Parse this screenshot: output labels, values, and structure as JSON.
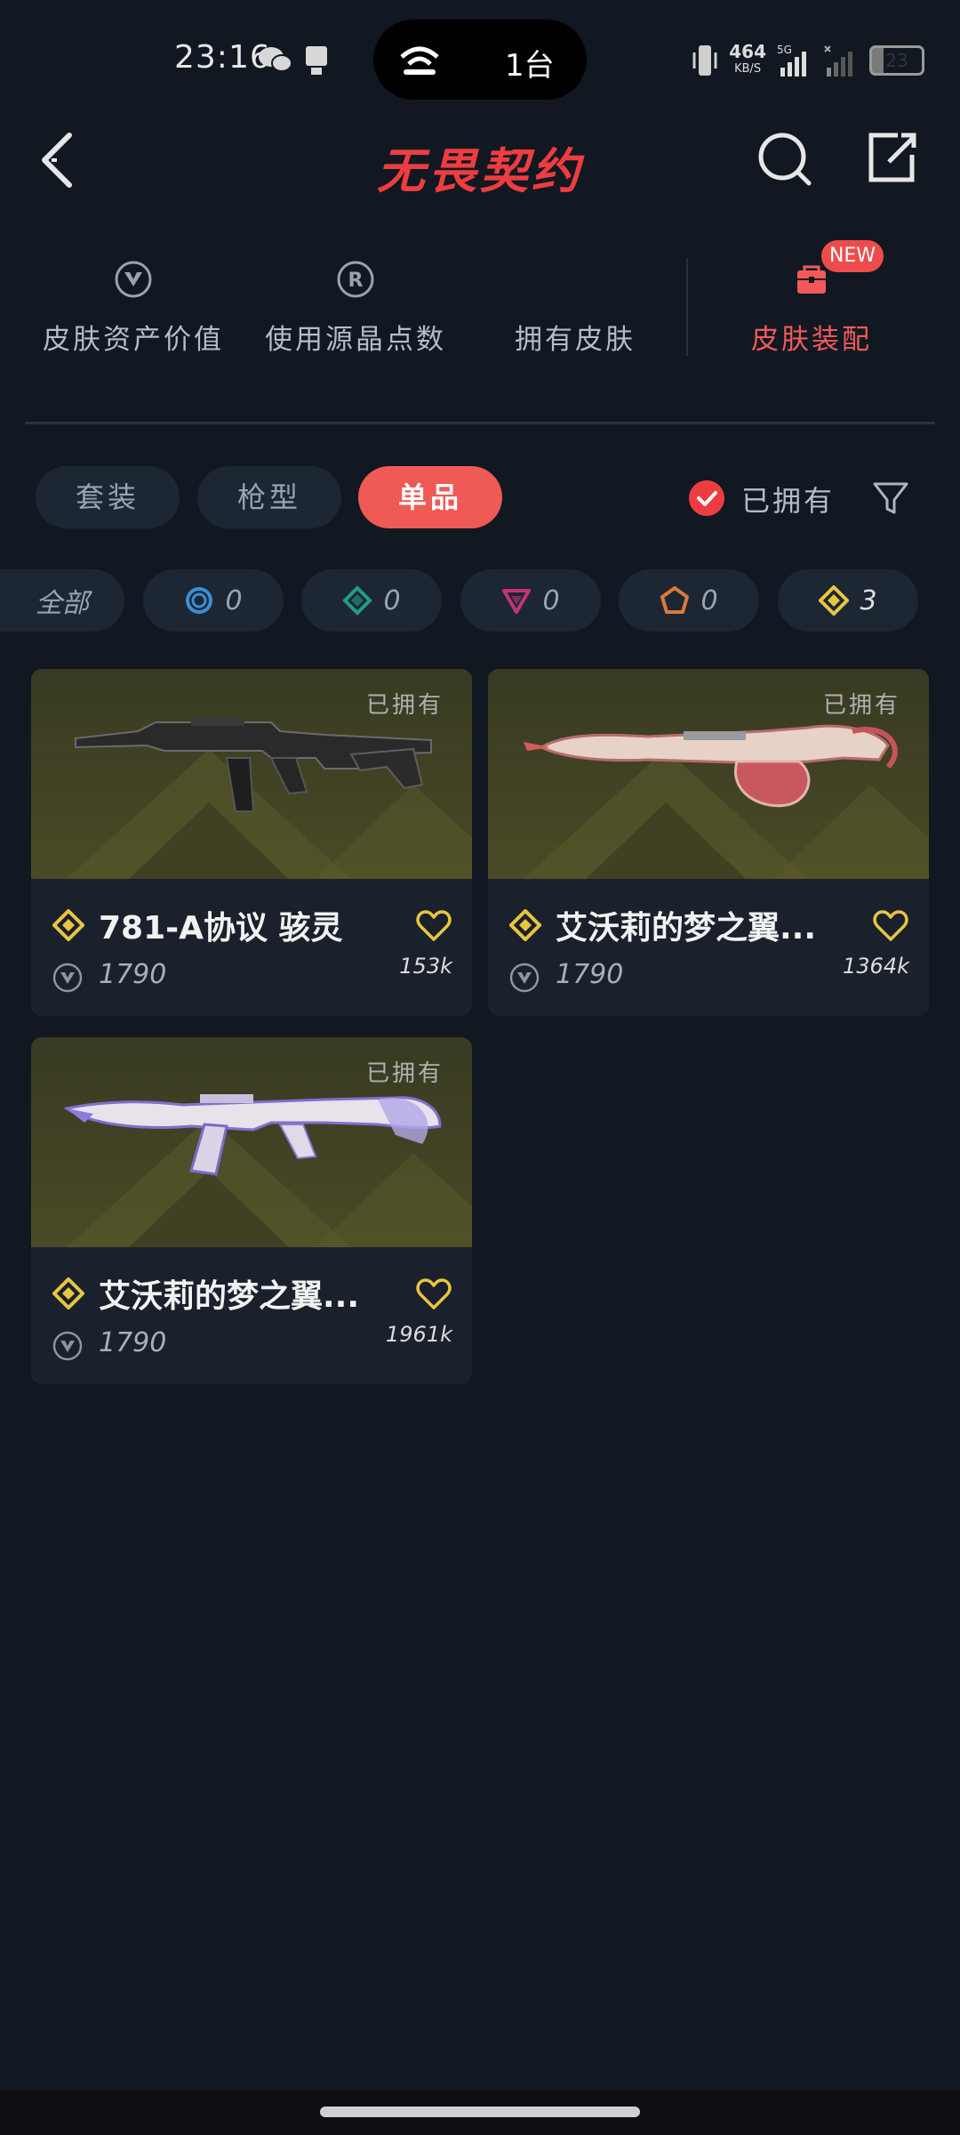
{
  "status_bar": {
    "time": "23:16",
    "island_count": "1台",
    "network_speed": "464",
    "network_speed_unit": "KB/S",
    "network_type": "5G",
    "battery": "23"
  },
  "header": {
    "title": "无畏契约",
    "icons": [
      "back-arrow-icon",
      "search-icon",
      "share-icon"
    ]
  },
  "top_nav": {
    "items": [
      {
        "label": "皮肤资产价值",
        "icon": "valorant-points-icon"
      },
      {
        "label": "使用源晶点数",
        "icon": "radianite-icon"
      },
      {
        "label": "拥有皮肤",
        "icon": ""
      },
      {
        "label": "皮肤装配",
        "icon": "locker-icon"
      }
    ],
    "new_badge": "NEW"
  },
  "filters": {
    "segments": [
      "套装",
      "枪型",
      "单品"
    ],
    "active_segment": "单品",
    "owned_toggle_label": "已拥有",
    "owned_checked": true
  },
  "tiers": [
    {
      "label": "全部",
      "count": ""
    },
    {
      "label": "select-tier",
      "count": "0",
      "color": "#3a8fd6"
    },
    {
      "label": "deluxe-tier",
      "count": "0",
      "color": "#1f9e8a"
    },
    {
      "label": "premium-tier",
      "count": "0",
      "color": "#c2337a"
    },
    {
      "label": "exclusive-tier",
      "count": "0",
      "color": "#d97a3a"
    },
    {
      "label": "ultra-tier",
      "count": "3",
      "color": "#e7c640"
    }
  ],
  "cards": [
    {
      "name": "781-A协议 骇灵",
      "price": "1790",
      "favorites": "153k",
      "owned_tag": "已拥有"
    },
    {
      "name": "艾沃莉的梦之翼...",
      "price": "1790",
      "favorites": "1364k",
      "owned_tag": "已拥有"
    },
    {
      "name": "艾沃莉的梦之翼...",
      "price": "1790",
      "favorites": "1961k",
      "owned_tag": "已拥有"
    }
  ],
  "colors": {
    "background": "#111821",
    "accent": "#ee3d40",
    "chip": "#1d2633",
    "ultra_gold": "#e7c640"
  }
}
